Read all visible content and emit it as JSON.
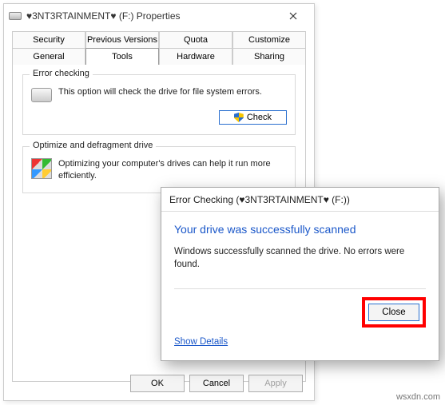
{
  "props_window": {
    "title": "♥3NT3RTAINMENT♥ (F:) Properties",
    "tabs_row1": [
      "Security",
      "Previous Versions",
      "Quota",
      "Customize"
    ],
    "tabs_row2": [
      "General",
      "Tools",
      "Hardware",
      "Sharing"
    ],
    "active_tab": "Tools",
    "error_checking": {
      "group_title": "Error checking",
      "desc": "This option will check the drive for file system errors.",
      "button": "Check"
    },
    "optimize": {
      "group_title": "Optimize and defragment drive",
      "desc": "Optimizing your computer's drives can help it run more efficiently."
    },
    "buttons": {
      "ok": "OK",
      "cancel": "Cancel",
      "apply": "Apply"
    }
  },
  "ec_dialog": {
    "title": "Error Checking (♥3NT3RTAINMENT♥ (F:))",
    "heading": "Your drive was successfully scanned",
    "message": "Windows successfully scanned the drive. No errors were found.",
    "close": "Close",
    "details": "Show Details"
  },
  "watermark": "wsxdn.com"
}
